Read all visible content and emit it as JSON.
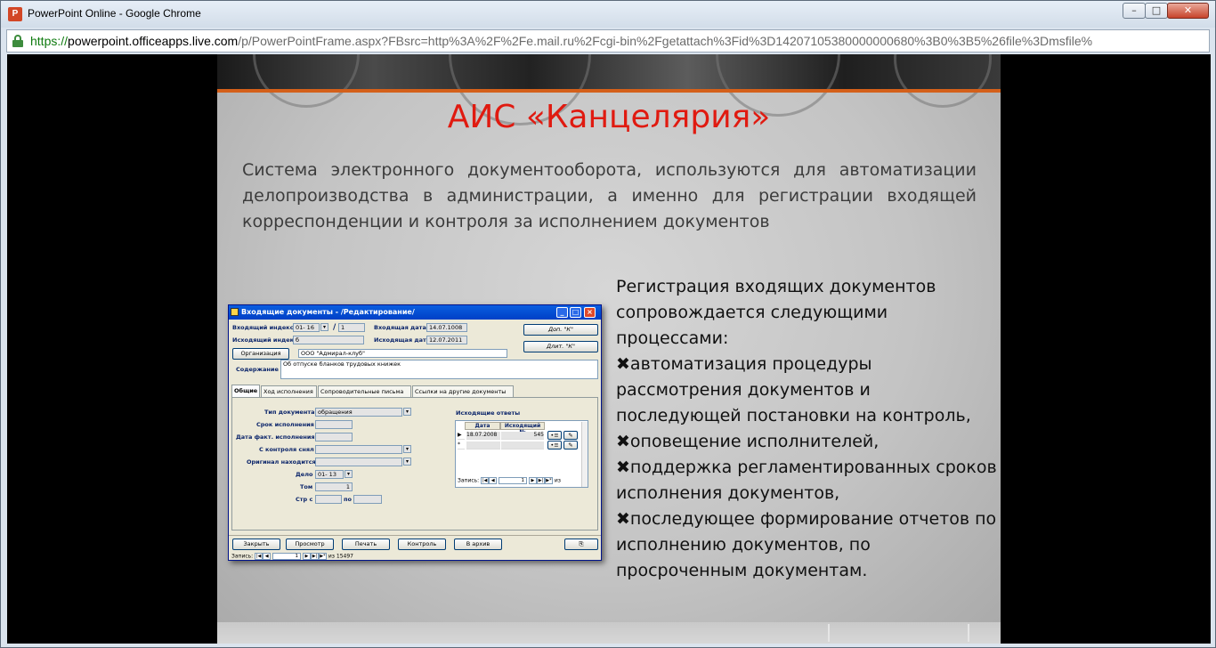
{
  "window": {
    "title": "PowerPoint Online - Google Chrome",
    "app_icon_letter": "P",
    "min": "–",
    "max": "□",
    "close": "✕"
  },
  "address": {
    "scheme": "https://",
    "host": "powerpoint.officeapps.live.com",
    "rest": "/p/PowerPointFrame.aspx?FBsrc=http%3A%2F%2Fe.mail.ru%2Fcgi-bin%2Fgetattach%3Fid%3D14207105380000000680%3B0%3B5%26file%3Dmsfile%"
  },
  "slide": {
    "title": "АИС «Канцелярия»",
    "body": "Система электронного документооборота, используются для автоматизации делопроизводства в администрации, а именно для регистрации входящей корреспонденции и контроля за исполнением документов",
    "right_intro": "Регистрация входящих  документов сопровождается следующими процессами:",
    "bullet_mark": "✖",
    "bullets": [
      "автоматизация процедуры рассмотрения документов и последующей постановки на контроль,",
      "оповещение исполнителей,",
      "поддержка регламентированных сроков исполнения документов,",
      "последующее формирование отчетов по исполнению документов, по просроченным документам."
    ]
  },
  "app": {
    "title": "Входящие документы - /Редактирование/",
    "in_index_label": "Входящий индекс",
    "in_index_value": "01- 16",
    "in_index_slash": "/",
    "in_index_num": "1",
    "in_date_label": "Входящая дата",
    "in_date_value": "14.07.1008",
    "out_index_label": "Исходящий индекс",
    "out_index_value": "б",
    "out_date_label": "Исходящая дата",
    "out_date_value": "12.07.2011",
    "org_button": "Организация",
    "org_value": "ООО \"Адмирал-клуб\"",
    "dop_button": "Доп. \"К\"",
    "dlit_button": "Длит. \"К\"",
    "content_label": "Содержание",
    "content_value": "Об отпуске бланков трудовых книжек",
    "tabs": [
      "Общие",
      "Ход исполнения",
      "Сопроводительные письма",
      "Ссылки на другие документы"
    ],
    "form": {
      "doc_type_label": "Тип документа",
      "doc_type_value": "обращения",
      "deadline_label": "Срок исполнения",
      "actual_date_label": "Дата факт. исполнения",
      "removed_label": "С контроля снял",
      "original_label": "Оригинал находится",
      "case_label": "Дело",
      "case_value": "01- 13",
      "volume_label": "Том",
      "volume_value": "1",
      "pages_label": "Стр с",
      "pages_to_label": "по"
    },
    "responses": {
      "title": "Исходящие ответы",
      "col_date": "Дата",
      "col_number": "Исходящий №",
      "row_date": "18.07.2008",
      "row_number": "545",
      "row_marker": "▶",
      "new_marker": "*",
      "nav_label": "Запись:",
      "nav_value": "1",
      "nav_of": "из",
      "nav_first": "|◀",
      "nav_prev": "◀",
      "nav_next": "▶",
      "nav_last": "▶|",
      "nav_new": "▶*"
    },
    "buttons": {
      "close": "Закрыть",
      "view": "Просмотр",
      "print": "Печать",
      "control": "Контроль",
      "archive": "В архив"
    },
    "footer_nav": {
      "label": "Запись:",
      "value": "1",
      "of": "из",
      "total": "15497"
    }
  }
}
